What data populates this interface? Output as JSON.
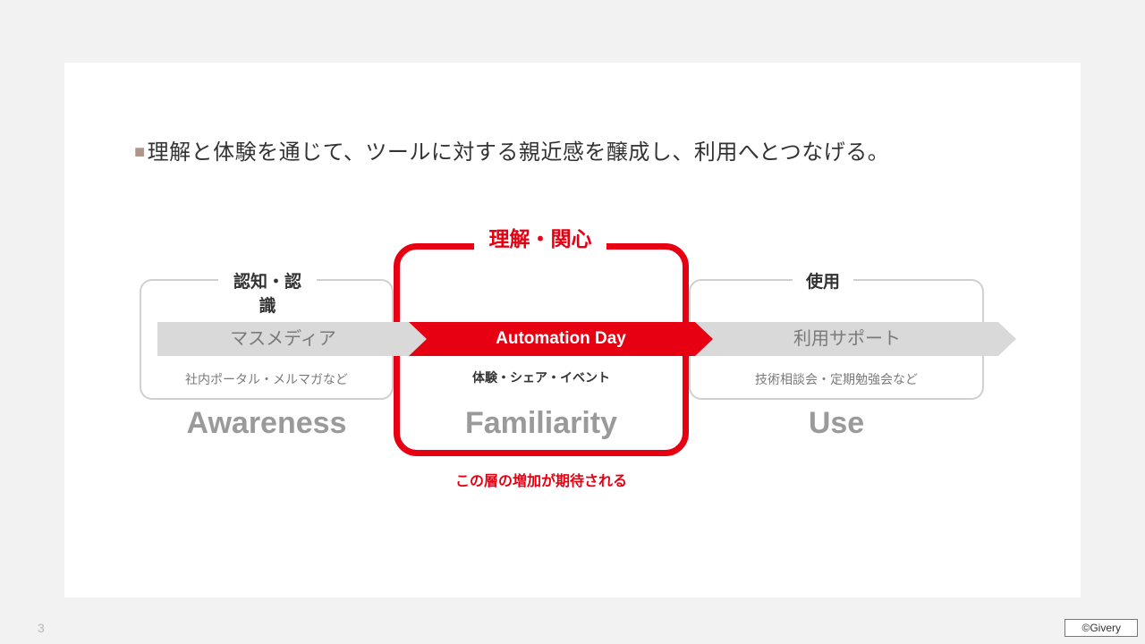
{
  "heading": "理解と体験を通じて、ツールに対する親近感を醸成し、利用へとつなげる。",
  "stages": {
    "left": {
      "jp": "認知・認識",
      "arrow": "マスメディア",
      "sub": "社内ポータル・メルマガなど",
      "en": "Awareness"
    },
    "mid": {
      "jp": "理解・関心",
      "arrow": "Automation Day",
      "sub": "体験・シェア・イベント",
      "en": "Familiarity"
    },
    "right": {
      "jp": "使用",
      "arrow": "利用サポート",
      "sub": "技術相談会・定期勉強会など",
      "en": "Use"
    }
  },
  "caption": "この層の増加が期待される",
  "page_number": "3",
  "copyright": "©Givery"
}
